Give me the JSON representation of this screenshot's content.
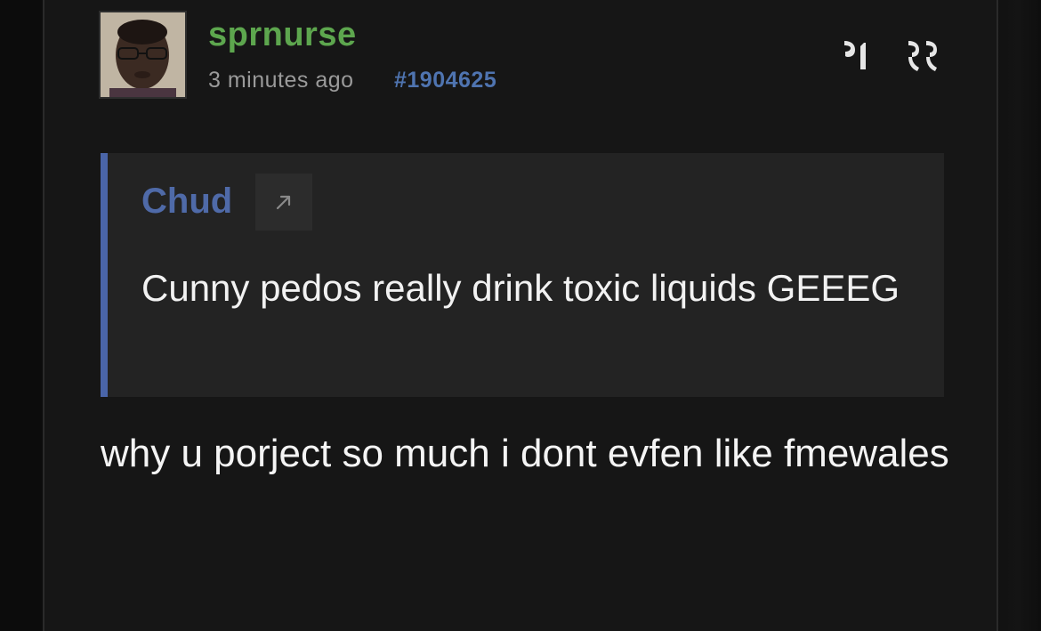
{
  "post": {
    "username": "sprnurse",
    "timestamp": "3 minutes ago",
    "post_id": "#1904625",
    "actions": {
      "quote_icon": "quote-open-icon",
      "reply_quote_icon": "quote-close-icon"
    },
    "quote": {
      "author": "Chud",
      "jump_icon": "arrow-up-right-icon",
      "text": "Cunny pedos really drink toxic liquids GEEEG"
    },
    "body": "why u porject so much i dont evfen like fmewales"
  },
  "colors": {
    "username": "#5da64e",
    "post_id": "#4f74b0",
    "quote_border": "#4a65a8",
    "quote_author": "#4f6aa8"
  }
}
